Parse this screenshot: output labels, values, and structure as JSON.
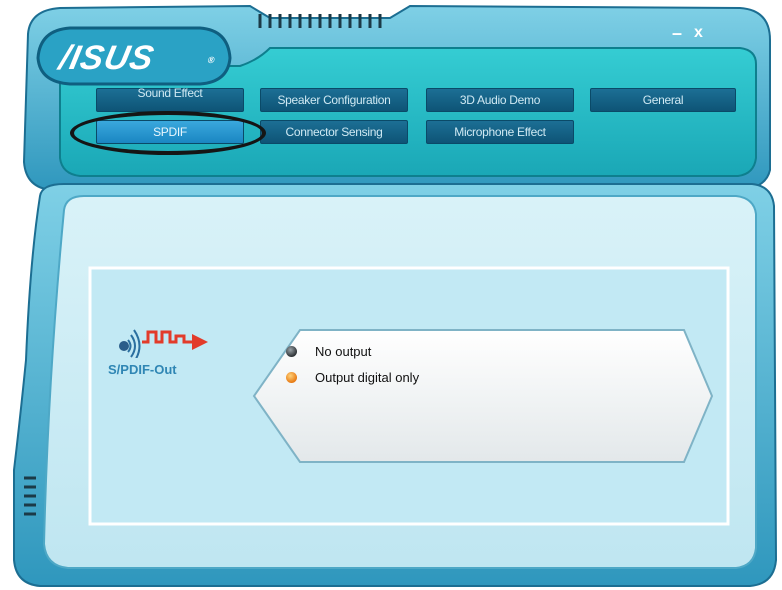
{
  "app": {
    "logo_text": "/ISUS",
    "logo_mark": "®"
  },
  "window_controls": {
    "minimize": "–",
    "close": "x"
  },
  "tabs": [
    {
      "label": "Sound Effect",
      "active": false
    },
    {
      "label": "Speaker Configuration",
      "active": false
    },
    {
      "label": "3D Audio Demo",
      "active": false
    },
    {
      "label": "General",
      "active": false
    },
    {
      "label": "SPDIF",
      "active": true
    },
    {
      "label": "Connector Sensing",
      "active": false
    },
    {
      "label": "Microphone Effect",
      "active": false
    }
  ],
  "panel": {
    "icon": "spdif-out-icon",
    "title": "S/PDIF-Out",
    "options": [
      {
        "label": "No output",
        "selected": false
      },
      {
        "label": "Output digital only",
        "selected": true
      }
    ]
  },
  "colors": {
    "frame": "#3fa9c9",
    "teal_panel": "#2ec3c9",
    "content_bg": "#cfeef6",
    "selected_radio": "#e77a14",
    "spdif_icon_accent": "#e23b2a"
  }
}
